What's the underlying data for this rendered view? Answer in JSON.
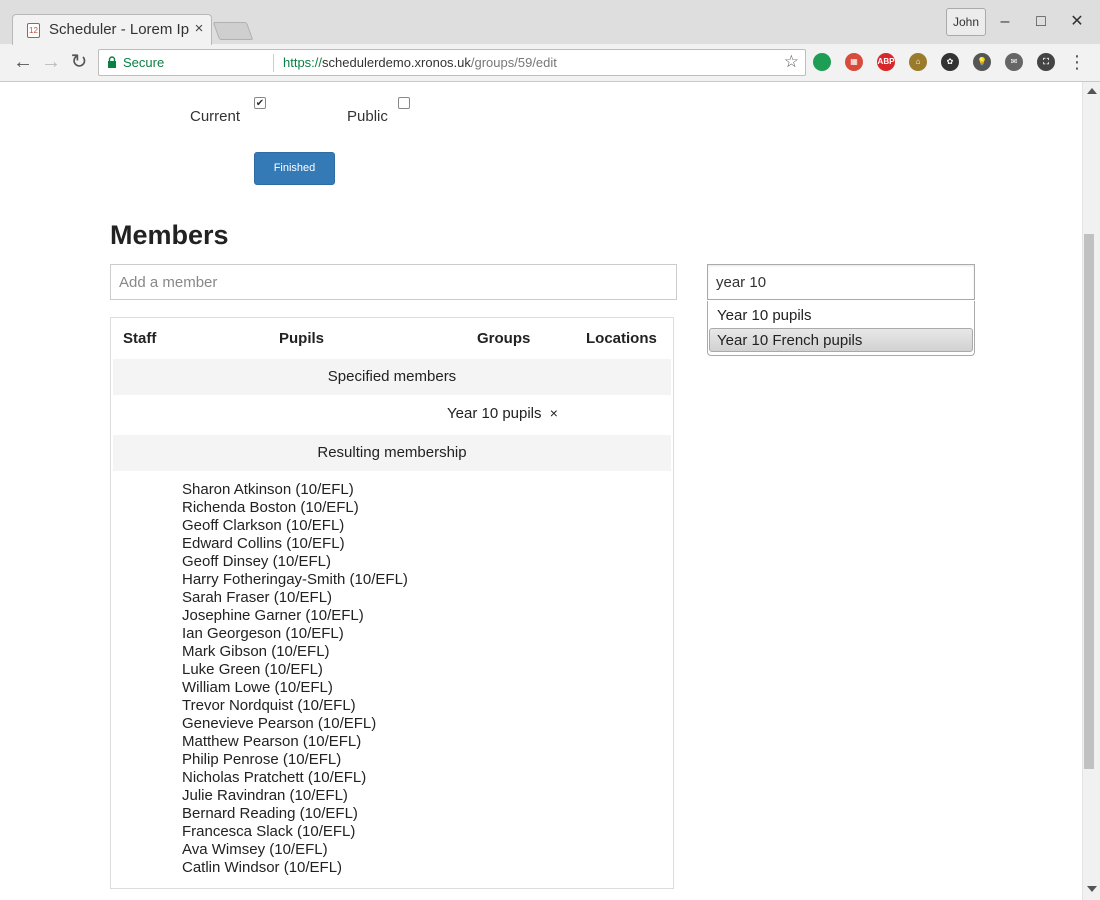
{
  "browser": {
    "tab_title": "Scheduler - Lorem Ipsum",
    "tab_close": "×",
    "profile": "John",
    "window_minimize": "–",
    "window_maximize": "□",
    "window_close": "✕",
    "back": "←",
    "forward": "→",
    "reload": "↻",
    "secure_label": "Secure",
    "url_scheme": "https://",
    "url_host": "schedulerdemo.xronos.uk",
    "url_path": "/groups/59/edit",
    "bookmark": "☆",
    "extensions": [
      {
        "name": "hangouts-extension",
        "color": "#1e9e55",
        "label": ""
      },
      {
        "name": "dashboard-extension",
        "color": "#d84b3c",
        "label": "▦"
      },
      {
        "name": "adblock-extension",
        "color": "#d9262b",
        "label": "ABP"
      },
      {
        "name": "house-extension",
        "color": "#9a7a2b",
        "label": "⌂"
      },
      {
        "name": "gnome-extension",
        "color": "#333333",
        "label": "✿"
      },
      {
        "name": "bulb-extension",
        "color": "#555555",
        "label": "💡"
      },
      {
        "name": "mail-extension",
        "color": "#666666",
        "label": "✉"
      },
      {
        "name": "screenshot-extension",
        "color": "#444444",
        "label": "⛶"
      }
    ],
    "menu": "⋮"
  },
  "form": {
    "current_label": "Current",
    "current_checked": true,
    "public_label": "Public",
    "public_checked": false,
    "finished_button": "Finished"
  },
  "members": {
    "heading": "Members",
    "add_placeholder": "Add a member",
    "search_value": "year 10",
    "suggestions": [
      "Year 10 pupils",
      "Year 10 French pupils"
    ],
    "columns": [
      "Staff",
      "Pupils",
      "Groups",
      "Locations"
    ],
    "specified_heading": "Specified members",
    "specified_tag": "Year 10 pupils",
    "remove_glyph": "×",
    "resulting_heading": "Resulting membership",
    "resulting": [
      "Sharon Atkinson (10/EFL)",
      "Richenda Boston (10/EFL)",
      "Geoff Clarkson (10/EFL)",
      "Edward Collins (10/EFL)",
      "Geoff Dinsey (10/EFL)",
      "Harry Fotheringay-Smith (10/EFL)",
      "Sarah Fraser (10/EFL)",
      "Josephine Garner (10/EFL)",
      "Ian Georgeson (10/EFL)",
      "Mark Gibson (10/EFL)",
      "Luke Green (10/EFL)",
      "William Lowe (10/EFL)",
      "Trevor Nordquist (10/EFL)",
      "Genevieve Pearson (10/EFL)",
      "Matthew Pearson (10/EFL)",
      "Philip Penrose (10/EFL)",
      "Nicholas Pratchett (10/EFL)",
      "Julie Ravindran (10/EFL)",
      "Bernard Reading (10/EFL)",
      "Francesca Slack (10/EFL)",
      "Ava Wimsey (10/EFL)",
      "Catlin Windsor (10/EFL)"
    ]
  }
}
